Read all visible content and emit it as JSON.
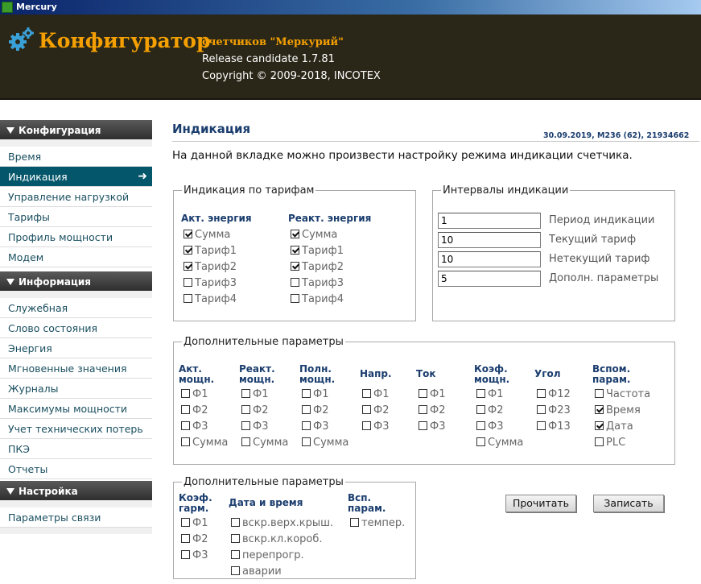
{
  "window": {
    "title": "Mercury"
  },
  "header": {
    "title": "Конфигуратор",
    "subtitle": "счетчиков \"Меркурий\"",
    "release": "Release candidate 1.7.81",
    "copyright": "Copyright © 2009-2018, INCOTEX"
  },
  "sidebar": {
    "sections": [
      {
        "label": "Конфигурация",
        "items": [
          "Время",
          "Индикация",
          "Управление нагрузкой",
          "Тарифы",
          "Профиль мощности",
          "Модем"
        ]
      },
      {
        "label": "Информация",
        "items": [
          "Служебная",
          "Слово состояния",
          "Энергия",
          "Мгновенные значения",
          "Журналы",
          "Максимумы мощности",
          "Учет технических потерь",
          "ПКЭ",
          "Отчеты"
        ]
      },
      {
        "label": "Настройка",
        "items": [
          "Параметры связи"
        ]
      }
    ],
    "active_item": "Индикация"
  },
  "main": {
    "title": "Индикация",
    "meta": "30.09.2019, M236 (62), 21934662",
    "description": "На данной вкладке можно произвести настройку режима индикации счетчика.",
    "tariffs": {
      "legend": "Индикация по тарифам",
      "columns": [
        {
          "header": "Акт. энергия",
          "items": [
            {
              "label": "Сумма",
              "checked": true
            },
            {
              "label": "Тариф1",
              "checked": true
            },
            {
              "label": "Тариф2",
              "checked": true
            },
            {
              "label": "Тариф3",
              "checked": false
            },
            {
              "label": "Тариф4",
              "checked": false
            }
          ]
        },
        {
          "header": "Реакт. энергия",
          "items": [
            {
              "label": "Сумма",
              "checked": true
            },
            {
              "label": "Тариф1",
              "checked": true
            },
            {
              "label": "Тариф2",
              "checked": true
            },
            {
              "label": "Тариф3",
              "checked": false
            },
            {
              "label": "Тариф4",
              "checked": false
            }
          ]
        }
      ]
    },
    "intervals": {
      "legend": "Интервалы индикации",
      "rows": [
        {
          "value": "1",
          "label": "Период индикации"
        },
        {
          "value": "10",
          "label": "Текущий тариф"
        },
        {
          "value": "10",
          "label": "Нетекущий тариф"
        },
        {
          "value": "5",
          "label": "Дополн. параметры"
        }
      ]
    },
    "extra1": {
      "legend": "Дополнительные параметры",
      "columns": [
        {
          "header": [
            "Акт.",
            "мощн."
          ],
          "items": [
            {
              "label": "Ф1",
              "checked": false
            },
            {
              "label": "Ф2",
              "checked": false
            },
            {
              "label": "Ф3",
              "checked": false
            },
            {
              "label": "Сумма",
              "checked": false
            }
          ]
        },
        {
          "header": [
            "Реакт.",
            "мощн."
          ],
          "items": [
            {
              "label": "Ф1",
              "checked": false
            },
            {
              "label": "Ф2",
              "checked": false
            },
            {
              "label": "Ф3",
              "checked": false
            },
            {
              "label": "Сумма",
              "checked": false
            }
          ]
        },
        {
          "header": [
            "Полн.",
            "мощн."
          ],
          "items": [
            {
              "label": "Ф1",
              "checked": false
            },
            {
              "label": "Ф2",
              "checked": false
            },
            {
              "label": "Ф3",
              "checked": false
            },
            {
              "label": "Сумма",
              "checked": false
            }
          ]
        },
        {
          "header": [
            "Напр."
          ],
          "items": [
            {
              "label": "Ф1",
              "checked": false
            },
            {
              "label": "Ф2",
              "checked": false
            },
            {
              "label": "Ф3",
              "checked": false
            }
          ]
        },
        {
          "header": [
            "Ток"
          ],
          "items": [
            {
              "label": "Ф1",
              "checked": false
            },
            {
              "label": "Ф2",
              "checked": false
            },
            {
              "label": "Ф3",
              "checked": false
            }
          ]
        },
        {
          "header": [
            "Коэф.",
            "мощн."
          ],
          "items": [
            {
              "label": "Ф1",
              "checked": false
            },
            {
              "label": "Ф2",
              "checked": false
            },
            {
              "label": "Ф3",
              "checked": false
            },
            {
              "label": "Сумма",
              "checked": false
            }
          ]
        },
        {
          "header": [
            "Угол"
          ],
          "items": [
            {
              "label": "Ф12",
              "checked": false
            },
            {
              "label": "Ф23",
              "checked": false
            },
            {
              "label": "Ф13",
              "checked": false
            }
          ]
        },
        {
          "header": [
            "Вспом.",
            "парам."
          ],
          "items": [
            {
              "label": "Частота",
              "checked": false
            },
            {
              "label": "Время",
              "checked": true
            },
            {
              "label": "Дата",
              "checked": true
            },
            {
              "label": "PLC",
              "checked": false
            }
          ]
        }
      ]
    },
    "extra2": {
      "legend": "Дополнительные параметры",
      "columns": [
        {
          "header": [
            "Коэф.",
            "гарм."
          ],
          "items": [
            {
              "label": "Ф1",
              "checked": false
            },
            {
              "label": "Ф2",
              "checked": false
            },
            {
              "label": "Ф3",
              "checked": false
            }
          ]
        },
        {
          "header": [
            "Дата и время"
          ],
          "items": [
            {
              "label": "вскр.верх.крыш.",
              "checked": false
            },
            {
              "label": "вскр.кл.короб.",
              "checked": false
            },
            {
              "label": "перепрогр.",
              "checked": false
            },
            {
              "label": "аварии",
              "checked": false
            }
          ]
        },
        {
          "header": [
            "Всп.",
            "парам."
          ],
          "items": [
            {
              "label": "темпер.",
              "checked": false
            }
          ]
        }
      ]
    },
    "buttons": {
      "read": "Прочитать",
      "write": "Записать"
    }
  },
  "colors": {
    "header_bg": "#2a2718",
    "accent": "#f5a000",
    "active_item": "#04566a",
    "heading": "#1a3d6e"
  }
}
